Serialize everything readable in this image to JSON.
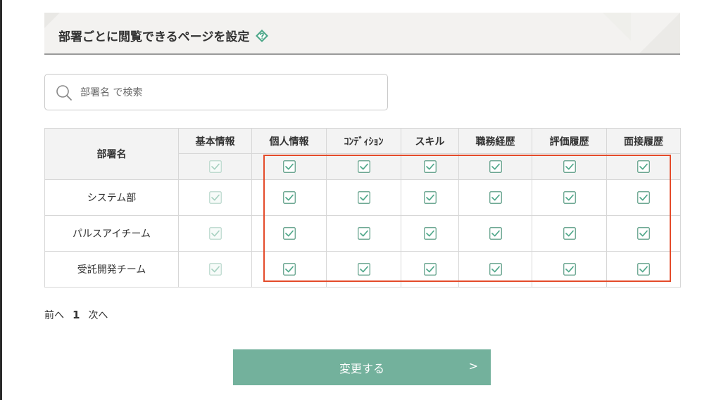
{
  "header": {
    "title": "部署ごとに閲覧できるページを設定",
    "help_icon": "help-diamond-icon",
    "accent_color": "#4fa88a"
  },
  "search": {
    "placeholder": "部署名 で検索",
    "value": ""
  },
  "table": {
    "dept_header": "部署名",
    "columns": [
      "基本情報",
      "個人情報",
      "ｺﾝﾃﾞｨｼｮﾝ",
      "スキル",
      "職務経歴",
      "評価履歴",
      "面接履歴"
    ],
    "select_all": [
      {
        "checked": true,
        "disabled": true
      },
      {
        "checked": true,
        "disabled": false
      },
      {
        "checked": true,
        "disabled": false
      },
      {
        "checked": true,
        "disabled": false
      },
      {
        "checked": true,
        "disabled": false
      },
      {
        "checked": true,
        "disabled": false
      },
      {
        "checked": true,
        "disabled": false
      }
    ],
    "rows": [
      {
        "dept": "システム部",
        "checks": [
          true,
          true,
          true,
          true,
          true,
          true,
          true
        ]
      },
      {
        "dept": "パルスアイチーム",
        "checks": [
          true,
          true,
          true,
          true,
          true,
          true,
          true
        ]
      },
      {
        "dept": "受託開発チーム",
        "checks": [
          true,
          true,
          true,
          true,
          true,
          true,
          true
        ]
      }
    ]
  },
  "pagination": {
    "prev_label": "前へ",
    "current_page": "1",
    "next_label": "次へ"
  },
  "submit": {
    "label": "変更する",
    "arrow": ">",
    "color": "#73b19c"
  },
  "highlight": {
    "color": "#e44b2a"
  }
}
